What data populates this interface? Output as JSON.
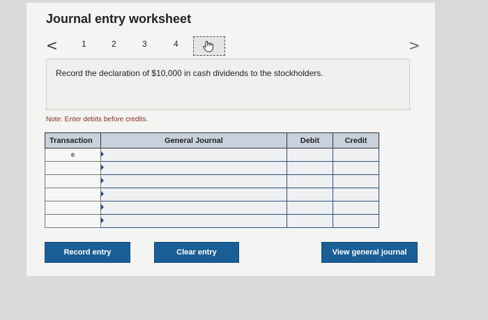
{
  "title": "Journal entry worksheet",
  "nav": {
    "prev_glyph": "<",
    "next_glyph": ">",
    "steps": [
      "1",
      "2",
      "3",
      "4"
    ],
    "current_step_icon": "hand-pointer-icon"
  },
  "question": "Record the declaration of $10,000 in cash dividends to the stockholders.",
  "note": "Note: Enter debits before credits.",
  "table": {
    "headers": [
      "Transaction",
      "General Journal",
      "Debit",
      "Credit"
    ],
    "rows": [
      {
        "transaction": "e",
        "account": "",
        "debit": "",
        "credit": ""
      },
      {
        "transaction": "",
        "account": "",
        "debit": "",
        "credit": ""
      },
      {
        "transaction": "",
        "account": "",
        "debit": "",
        "credit": ""
      },
      {
        "transaction": "",
        "account": "",
        "debit": "",
        "credit": ""
      },
      {
        "transaction": "",
        "account": "",
        "debit": "",
        "credit": ""
      },
      {
        "transaction": "",
        "account": "",
        "debit": "",
        "credit": ""
      }
    ]
  },
  "buttons": {
    "record": "Record entry",
    "clear": "Clear entry",
    "view": "View general journal"
  },
  "colors": {
    "button": "#1a5e96",
    "header": "#c9d2dc",
    "note": "#8b2b1e"
  }
}
